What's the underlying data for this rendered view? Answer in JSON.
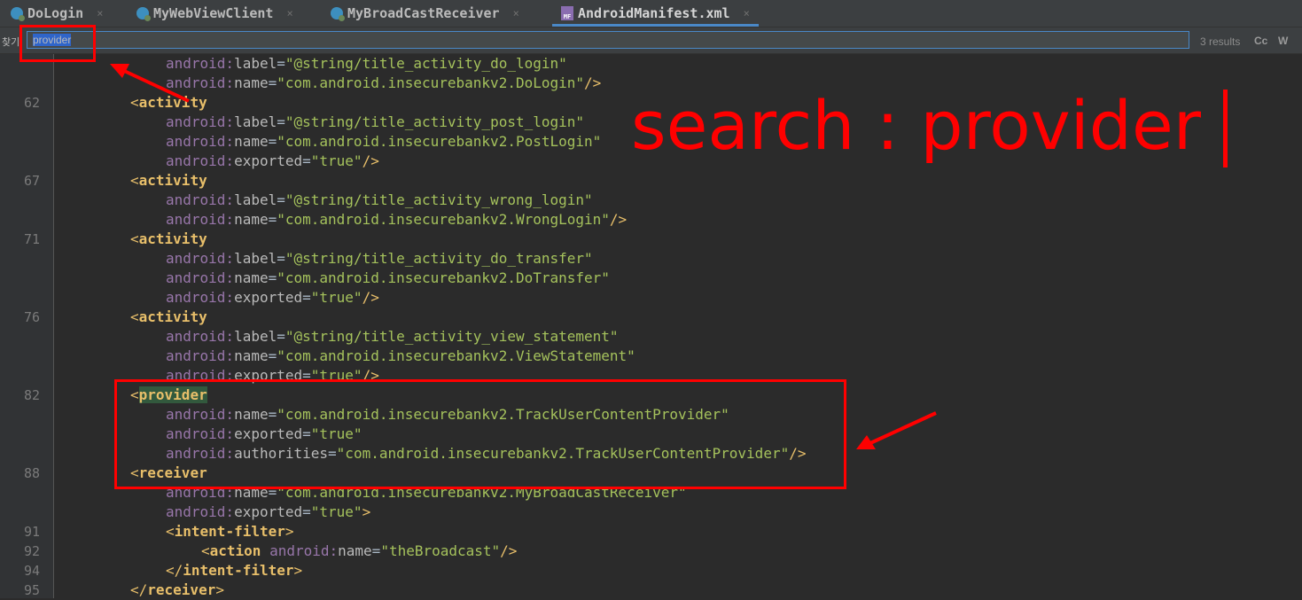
{
  "tabs": [
    {
      "label": "DoLogin",
      "icon": "class-icon",
      "close": "×"
    },
    {
      "label": "MyWebViewClient",
      "icon": "class-icon",
      "close": "×"
    },
    {
      "label": "MyBroadCastReceiver",
      "icon": "class-icon",
      "close": "×"
    },
    {
      "label": "AndroidManifest.xml",
      "icon": "manifest-icon",
      "icon_text": "MF",
      "close": "×",
      "active": true
    }
  ],
  "search": {
    "label": "찾기:",
    "value": "provider",
    "results": "3 results",
    "match_case": "Cc",
    "words": "W"
  },
  "line_numbers": [
    "62",
    "67",
    "71",
    "76",
    "82",
    "88",
    "91",
    "92",
    "94",
    "95"
  ],
  "code": {
    "l0": {
      "ns": "android:",
      "attr": "label",
      "eq": "=",
      "val": "\"@string/title_activity_do_login\""
    },
    "l1": {
      "ns": "android:",
      "attr": "name",
      "eq": "=",
      "val": "\"com.android.insecurebankv2.DoLogin\"",
      "close": "/>"
    },
    "l2": {
      "open": "<",
      "tag": "activity"
    },
    "l3": {
      "ns": "android:",
      "attr": "label",
      "eq": "=",
      "val": "\"@string/title_activity_post_login\""
    },
    "l4": {
      "ns": "android:",
      "attr": "name",
      "eq": "=",
      "val": "\"com.android.insecurebankv2.PostLogin\""
    },
    "l5": {
      "ns": "android:",
      "attr": "exported",
      "eq": "=",
      "val": "\"true\"",
      "close": "/>"
    },
    "l6": {
      "open": "<",
      "tag": "activity"
    },
    "l7": {
      "ns": "android:",
      "attr": "label",
      "eq": "=",
      "val": "\"@string/title_activity_wrong_login\""
    },
    "l8": {
      "ns": "android:",
      "attr": "name",
      "eq": "=",
      "val": "\"com.android.insecurebankv2.WrongLogin\"",
      "close": "/>"
    },
    "l9": {
      "open": "<",
      "tag": "activity"
    },
    "l10": {
      "ns": "android:",
      "attr": "label",
      "eq": "=",
      "val": "\"@string/title_activity_do_transfer\""
    },
    "l11": {
      "ns": "android:",
      "attr": "name",
      "eq": "=",
      "val": "\"com.android.insecurebankv2.DoTransfer\""
    },
    "l12": {
      "ns": "android:",
      "attr": "exported",
      "eq": "=",
      "val": "\"true\"",
      "close": "/>"
    },
    "l13": {
      "open": "<",
      "tag": "activity"
    },
    "l14": {
      "ns": "android:",
      "attr": "label",
      "eq": "=",
      "val": "\"@string/title_activity_view_statement\""
    },
    "l15": {
      "ns": "android:",
      "attr": "name",
      "eq": "=",
      "val": "\"com.android.insecurebankv2.ViewStatement\""
    },
    "l16": {
      "ns": "android:",
      "attr": "exported",
      "eq": "=",
      "val": "\"true\"",
      "close": "/>"
    },
    "l17": {
      "open": "<",
      "tag": "provider"
    },
    "l18": {
      "ns": "android:",
      "attr": "name",
      "eq": "=",
      "val": "\"com.android.insecurebankv2.TrackUserContentProvider\""
    },
    "l19": {
      "ns": "android:",
      "attr": "exported",
      "eq": "=",
      "val": "\"true\""
    },
    "l20": {
      "ns": "android:",
      "attr": "authorities",
      "eq": "=",
      "val": "\"com.android.insecurebankv2.TrackUserContentProvider\"",
      "close": "/>"
    },
    "l21": {
      "open": "<",
      "tag": "receiver"
    },
    "l22": {
      "ns": "android:",
      "attr": "name",
      "eq": "=",
      "val": "\"com.android.insecurebankv2.MyBroadCastReceiver\""
    },
    "l23": {
      "ns": "android:",
      "attr": "exported",
      "eq": "=",
      "val": "\"true\"",
      "close": ">"
    },
    "l24": {
      "open": "<",
      "tag": "intent-filter",
      "close": ">"
    },
    "l25": {
      "open": "<",
      "tag": "action",
      "ns": "android:",
      "attr": "name",
      "eq": "=",
      "val": "\"theBroadcast\"",
      "close": "/>"
    },
    "l26": {
      "open": "</",
      "tag": "intent-filter",
      "close": ">"
    },
    "l27": {
      "open": "</",
      "tag": "receiver",
      "close": ">"
    }
  },
  "annotation": {
    "text": "search : provider",
    "color": "#ff0000"
  },
  "colors": {
    "background": "#2b2b2b",
    "gutter": "#313335",
    "tag": "#e8bf6a",
    "namespace": "#9876aa",
    "value": "#a5c25c",
    "annotation": "#ff0000",
    "accent": "#4a88c7"
  }
}
